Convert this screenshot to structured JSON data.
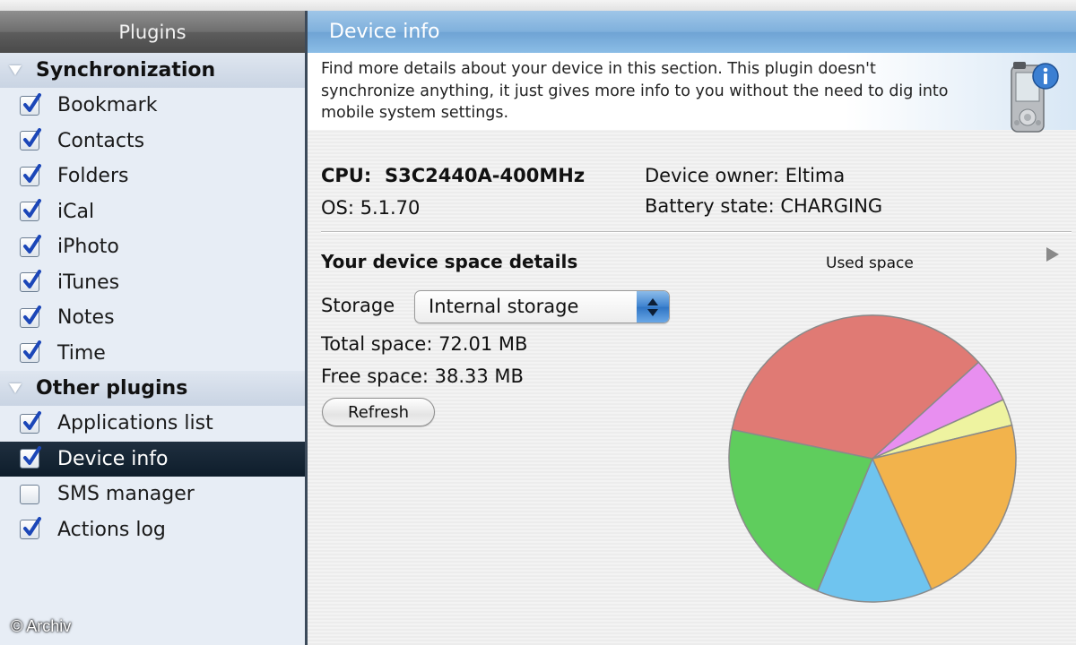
{
  "sidebar": {
    "header": "Plugins",
    "groups": [
      {
        "label": "Synchronization",
        "items": [
          {
            "label": "Bookmark",
            "checked": true
          },
          {
            "label": "Contacts",
            "checked": true
          },
          {
            "label": "Folders",
            "checked": true
          },
          {
            "label": "iCal",
            "checked": true
          },
          {
            "label": "iPhoto",
            "checked": true
          },
          {
            "label": "iTunes",
            "checked": true
          },
          {
            "label": "Notes",
            "checked": true
          },
          {
            "label": "Time",
            "checked": true
          }
        ]
      },
      {
        "label": "Other plugins",
        "items": [
          {
            "label": "Applications list",
            "checked": true
          },
          {
            "label": "Device info",
            "checked": true,
            "selected": true
          },
          {
            "label": "SMS manager",
            "checked": false
          },
          {
            "label": "Actions log",
            "checked": true
          }
        ]
      }
    ]
  },
  "watermark": "© Archiv",
  "main": {
    "header": "Device info",
    "description": "Find more details about your device in this section. This plugin doesn't synchronize anything, it just gives more info to you without the need to dig into mobile system settings.",
    "cpu_label": "CPU:",
    "cpu_value": "S3C2440A-400MHz",
    "os": "OS: 5.1.70",
    "owner": "Device owner: Eltima",
    "battery": "Battery state: CHARGING",
    "space_title": "Your device space details",
    "storage_label": "Storage",
    "storage_selected": "Internal storage",
    "total_space": "Total space: 72.01 MB",
    "free_space": "Free space: 38.33 MB",
    "refresh_label": "Refresh"
  },
  "chart_data": {
    "type": "pie",
    "title": "Used space",
    "slices": [
      {
        "value": 0.35,
        "color": "#e07a74"
      },
      {
        "value": 0.05,
        "color": "#e88ff0"
      },
      {
        "value": 0.03,
        "color": "#eef3a0"
      },
      {
        "value": 0.22,
        "color": "#f2b34c"
      },
      {
        "value": 0.13,
        "color": "#6fc4ef"
      },
      {
        "value": 0.22,
        "color": "#5fcd5d"
      }
    ]
  },
  "colors": {
    "selection": "#14232f",
    "accent_blue": "#7fb0dc",
    "check": "#1c47b8"
  }
}
